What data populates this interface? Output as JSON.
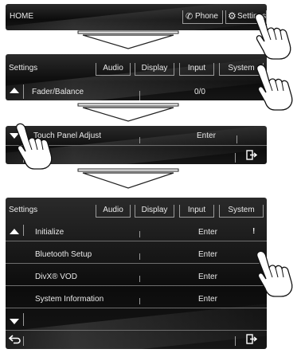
{
  "step1": {
    "home_label": "HOME",
    "phone_label": "Phone",
    "settings_label": "Settings"
  },
  "step2": {
    "title": "Settings",
    "tabs": [
      "Audio",
      "Display",
      "Input",
      "System"
    ],
    "row_label": "Fader/Balance",
    "row_value": "0/0"
  },
  "step3": {
    "row_label": "Touch Panel Adjust",
    "row_value": "Enter"
  },
  "step4": {
    "title": "Settings",
    "tabs": [
      "Audio",
      "Display",
      "Input",
      "System"
    ],
    "rows": [
      {
        "label": "Initialize",
        "value": "Enter"
      },
      {
        "label": "Bluetooth Setup",
        "value": "Enter"
      },
      {
        "label": "DivX® VOD",
        "value": "Enter"
      },
      {
        "label": "System Information",
        "value": "Enter"
      }
    ]
  },
  "icons": {
    "phone": "phone-icon",
    "settings": "gear-icon",
    "scroll_up": "triangle-up-icon",
    "scroll_down": "triangle-down-icon",
    "exit": "exit-icon",
    "back": "back-arrow-icon",
    "warning": "exclamation-icon",
    "hand": "pointing-hand-icon",
    "arrow": "funnel-arrow-icon"
  }
}
